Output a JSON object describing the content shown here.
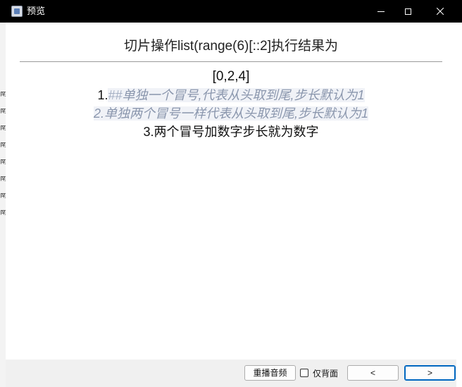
{
  "window": {
    "title": "预览"
  },
  "icons": {
    "app": "app-icon",
    "minimize": "minimize-icon",
    "maximize": "maximize-icon",
    "close": "close-icon"
  },
  "content": {
    "heading": "切片操作list(range(6)[::2]执行结果为",
    "result": "[0,2,4]",
    "line1_num": "1.",
    "line1_hash": "##",
    "line1_text": "单独一个冒号,代表从头取到尾,步长默认为1",
    "line2_text": "2.单独两个冒号一样代表从头取到尾,步长默认为1",
    "line3_text": "3.两个冒号加数字步长就为数字"
  },
  "controls": {
    "replay_label": "重播音频",
    "back_only_label": "仅背面",
    "back_only_checked": false,
    "prev_label": "<",
    "next_label": ">"
  },
  "colors": {
    "titlebar": "#000000",
    "highlight_bg": "#f0f2f7",
    "highlight_text": "#8a96ad",
    "accent_border": "#0067c0"
  }
}
